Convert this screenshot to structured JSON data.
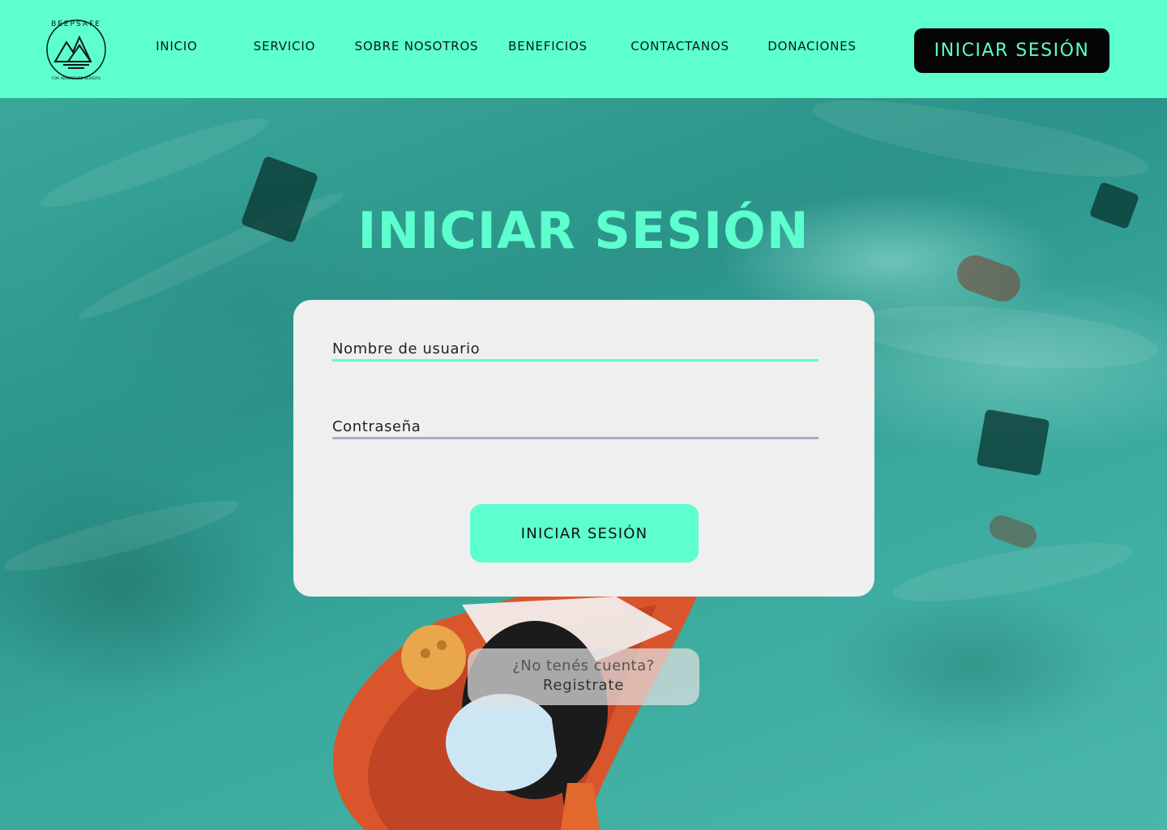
{
  "brand": {
    "name": "BEEPSAFE",
    "tagline": "FOR ADVENTURE SEEKERS"
  },
  "nav": {
    "items": [
      {
        "label": "INICIO"
      },
      {
        "label": "SERVICIO"
      },
      {
        "label": "SOBRE NOSOTROS"
      },
      {
        "label": "BENEFICIOS"
      },
      {
        "label": "CONTACTANOS"
      },
      {
        "label": "DONACIONES"
      }
    ],
    "login_button": "INICIAR SESIÓN"
  },
  "login": {
    "title": "INICIAR SESIÓN",
    "username_placeholder": "Nombre de usuario",
    "password_placeholder": "Contraseña",
    "submit_label": "INICIAR SESIÓN"
  },
  "register": {
    "question": "¿No tenés cuenta?",
    "link_label": "Registrate"
  },
  "colors": {
    "accent": "#5cffcd",
    "dark": "#050505",
    "card": "#efefef",
    "password_underline": "#b3a9c1"
  }
}
